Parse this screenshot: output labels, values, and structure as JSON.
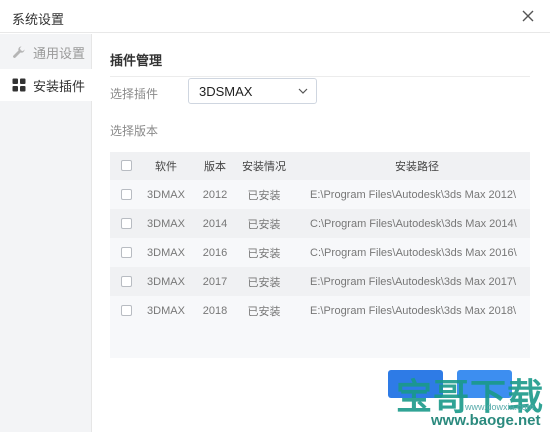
{
  "window": {
    "title": "系统设置"
  },
  "sidebar": {
    "items": [
      {
        "label": "通用设置",
        "icon": "wrench-icon",
        "active": false
      },
      {
        "label": "安装插件",
        "icon": "grid-icon",
        "active": true
      }
    ]
  },
  "main": {
    "section_title": "插件管理",
    "plugin_label": "选择插件",
    "plugin_select": {
      "value": "3DSMAX"
    },
    "version_label": "选择版本",
    "table": {
      "headers": {
        "software": "软件",
        "version": "版本",
        "status": "安装情况",
        "path": "安装路径"
      },
      "rows": [
        {
          "software": "3DMAX",
          "version": "2012",
          "status": "已安装",
          "path": "E:\\Program Files\\Autodesk\\3ds Max 2012\\"
        },
        {
          "software": "3DMAX",
          "version": "2014",
          "status": "已安装",
          "path": "C:\\Program Files\\Autodesk\\3ds Max 2014\\"
        },
        {
          "software": "3DMAX",
          "version": "2016",
          "status": "已安装",
          "path": "C:\\Program Files\\Autodesk\\3ds Max 2016\\"
        },
        {
          "software": "3DMAX",
          "version": "2017",
          "status": "已安装",
          "path": "E:\\Program Files\\Autodesk\\3ds Max 2017\\"
        },
        {
          "software": "3DMAX",
          "version": "2018",
          "status": "已安装",
          "path": "E:\\Program Files\\Autodesk\\3ds Max 2018\\"
        }
      ]
    },
    "buttons": {
      "install": "",
      "uninstall": ""
    }
  },
  "watermark": {
    "brand": "宝哥下载",
    "sub_url": "www.dowxia.com",
    "url": "www.baoge.net"
  },
  "colors": {
    "primary": "#2e7be6",
    "watermark": "#1a9a8a"
  }
}
